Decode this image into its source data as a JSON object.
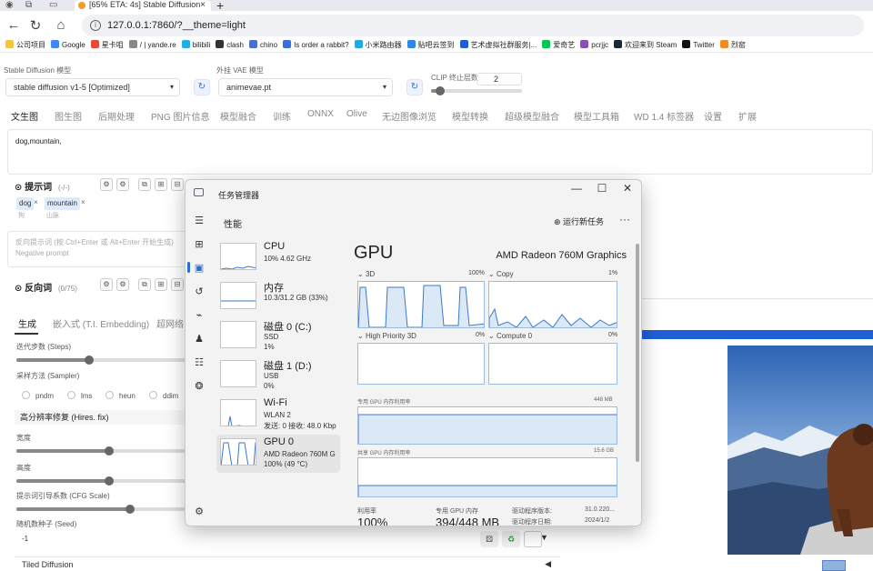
{
  "browser": {
    "tab_title": "[65% ETA: 4s] Stable Diffusion",
    "url": "127.0.0.1:7860/?__theme=light",
    "bookmarks": [
      {
        "label": "公司项目",
        "color": "#f4c542"
      },
      {
        "label": "Google",
        "color": "#4285f4"
      },
      {
        "label": "星卡咀",
        "color": "#e84a3a"
      },
      {
        "label": "/ | yande.re",
        "color": "#888888"
      },
      {
        "label": "bilibili",
        "color": "#23ade5"
      },
      {
        "label": "clash",
        "color": "#333333"
      },
      {
        "label": "chino",
        "color": "#4a6fd1"
      },
      {
        "label": "Is order a rabbit?",
        "color": "#3b6fd8"
      },
      {
        "label": "小米路由器",
        "color": "#26a9e0"
      },
      {
        "label": "贴吧云签到",
        "color": "#2f87e6"
      },
      {
        "label": "艺术虚拟社群服务|...",
        "color": "#1d5fd0"
      },
      {
        "label": "爱奇艺",
        "color": "#00c853"
      },
      {
        "label": "pcrjjc",
        "color": "#8b4fb8"
      },
      {
        "label": "欢迎来到 Steam",
        "color": "#1b2838"
      },
      {
        "label": "Twitter",
        "color": "#111111"
      },
      {
        "label": "烈窑",
        "color": "#f08a24"
      }
    ]
  },
  "sd": {
    "model_label": "Stable Diffusion 模型",
    "model_value": "stable diffusion v1-5 [Optimized]",
    "vae_label": "外挂 VAE 模型",
    "vae_value": "animevae.pt",
    "clip_label": "CLIP 终止层数",
    "clip_value": "2",
    "tabs": [
      "文生图",
      "图生图",
      "后期处理",
      "PNG 图片信息",
      "模型融合",
      "训练",
      "ONNX",
      "Olive",
      "无边图像浏览",
      "模型转换",
      "超级模型融合",
      "模型工具箱",
      "WD 1.4 标签器",
      "设置",
      "扩展"
    ],
    "prompt_text": "dog,mountain,",
    "prompt_section": "提示词",
    "prompt_count": "(-/-)",
    "tags": [
      {
        "label": "dog",
        "sub": "狗"
      },
      {
        "label": "mountain",
        "sub": "山脉"
      }
    ],
    "neg_placeholder_cn": "反向提示词 (按 Ctrl+Enter 或 Alt+Enter 开始生成)",
    "neg_placeholder_en": "Negative prompt",
    "neg_section": "反向词",
    "neg_count": "(0/75)",
    "gen_tabs": [
      "生成",
      "嵌入式 (T.I. Embedding)",
      "超网络"
    ],
    "steps_label": "迭代步数 (Steps)",
    "sampler_label": "采样方法 (Sampler)",
    "samplers": [
      "pndm",
      "lms",
      "heun",
      "ddim"
    ],
    "hires_label": "高分辨率修复 (Hires. fix)",
    "width_label": "宽度",
    "height_label": "高度",
    "cfg_label": "提示词引导系数 (CFG Scale)",
    "seed_label": "随机数种子 (Seed)",
    "seed_value": "-1",
    "tiled_label": "Tiled Diffusion"
  },
  "taskmgr": {
    "title": "任务管理器",
    "header": "性能",
    "new_task": "运行新任务",
    "devices": [
      {
        "name": "CPU",
        "sub1": "10% 4.62 GHz",
        "sub2": ""
      },
      {
        "name": "内存",
        "sub1": "10.3/31.2 GB (33%)",
        "sub2": ""
      },
      {
        "name": "磁盘 0 (C:)",
        "sub1": "SSD",
        "sub2": "1%"
      },
      {
        "name": "磁盘 1 (D:)",
        "sub1": "USB",
        "sub2": "0%"
      },
      {
        "name": "Wi-Fi",
        "sub1": "WLAN 2",
        "sub2": "发送: 0 接收: 48.0 Kbp"
      },
      {
        "name": "GPU 0",
        "sub1": "AMD Radeon 760M G",
        "sub2": "100% (49 °C)"
      }
    ],
    "gpu_title": "GPU",
    "gpu_model": "AMD Radeon 760M Graphics",
    "engines": [
      {
        "name": "3D",
        "pct": "100%"
      },
      {
        "name": "Copy",
        "pct": "1%"
      },
      {
        "name": "High Priority 3D",
        "pct": "0%"
      },
      {
        "name": "Compute 0",
        "pct": "0%"
      }
    ],
    "dedicated_label": "专用 GPU 内存利用率",
    "dedicated_value": "448 MB",
    "shared_label": "共享 GPU 内存利用率",
    "shared_value": "15.6 GB",
    "util_label": "利用率",
    "util_value": "100%",
    "mem_label": "专用 GPU 内存",
    "mem_value": "394/448 MB",
    "driver_version_label": "驱动程序版本:",
    "driver_version": "31.0.220...",
    "driver_date_label": "驱动程序日期:",
    "driver_date": "2024/1/2"
  }
}
